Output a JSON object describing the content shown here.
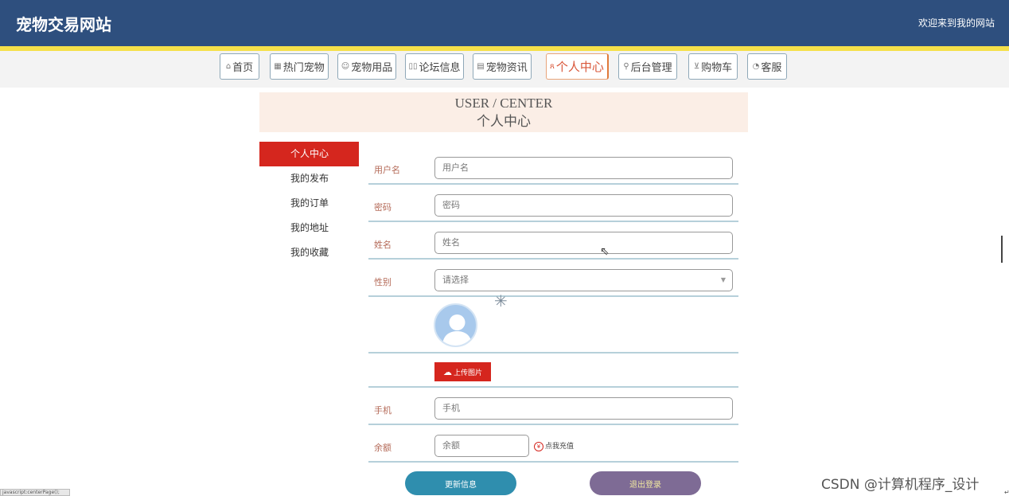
{
  "header": {
    "site_title": "宠物交易网站",
    "welcome": "欢迎来到我的网站"
  },
  "nav": [
    {
      "icon": "home-icon",
      "glyph": "⌂",
      "label": "首页"
    },
    {
      "icon": "grid-icon",
      "glyph": "▦",
      "label": "热门宠物"
    },
    {
      "icon": "smile-icon",
      "glyph": "☺",
      "label": "宠物用品"
    },
    {
      "icon": "book-icon",
      "glyph": "▯▯",
      "label": "论坛信息"
    },
    {
      "icon": "news-icon",
      "glyph": "▤",
      "label": "宠物资讯"
    },
    {
      "icon": "user-icon",
      "glyph": "ጸ",
      "label": "个人中心"
    },
    {
      "icon": "link-icon",
      "glyph": "⚲",
      "label": "后台管理"
    },
    {
      "icon": "cart-icon",
      "glyph": "⊻",
      "label": "购物车"
    },
    {
      "icon": "headset-icon",
      "glyph": "◔",
      "label": "客服"
    }
  ],
  "banner": {
    "en": "USER / CENTER",
    "cn": "个人中心"
  },
  "sidebar": {
    "items": [
      {
        "label": "个人中心"
      },
      {
        "label": "我的发布"
      },
      {
        "label": "我的订单"
      },
      {
        "label": "我的地址"
      },
      {
        "label": "我的收藏"
      }
    ]
  },
  "form": {
    "username": {
      "label": "用户名",
      "placeholder": "用户名"
    },
    "password": {
      "label": "密码",
      "placeholder": "密码"
    },
    "name": {
      "label": "姓名",
      "placeholder": "姓名"
    },
    "gender": {
      "label": "性别",
      "placeholder": "请选择"
    },
    "upload_label": "上传图片",
    "phone": {
      "label": "手机",
      "placeholder": "手机"
    },
    "balance": {
      "label": "余额",
      "placeholder": "余额"
    },
    "recharge_icon": "¥",
    "recharge_label": "点我充值"
  },
  "buttons": {
    "update": "更新信息",
    "logout": "退出登录"
  },
  "status_bar": {
    "url": "javascript:centerPage();"
  },
  "watermark": "CSDN @计算机程序_设计",
  "colors": {
    "header": "#2e4f7e",
    "accent_red": "#d5261e",
    "update_button": "#2f8eae",
    "logout_button": "#7e6b95"
  }
}
